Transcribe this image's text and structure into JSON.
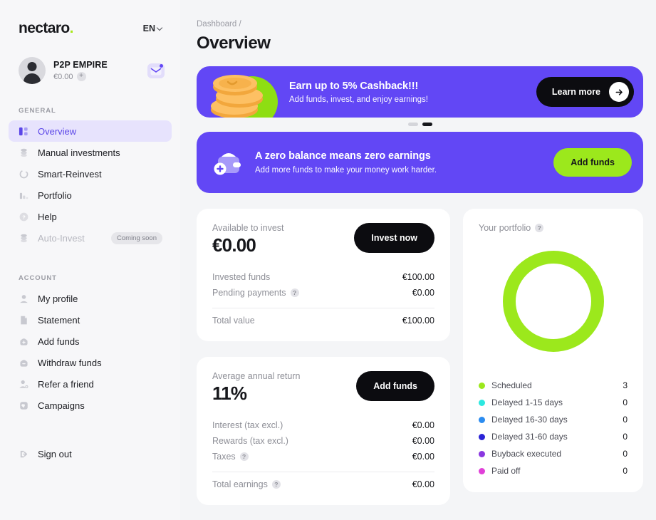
{
  "sidebar": {
    "logo": "nectaro",
    "logo_dot": ".",
    "language": "EN",
    "profile": {
      "name": "P2P EMPIRE",
      "balance": "€0.00",
      "add_symbol": "+",
      "mail_icon": "envelope-icon"
    },
    "group_general": "GENERAL",
    "group_account": "ACCOUNT",
    "general_items": [
      {
        "label": "Overview",
        "icon": "dashboard-icon",
        "active": true,
        "disabled": false
      },
      {
        "label": "Manual investments",
        "icon": "coins-stack-icon",
        "active": false,
        "disabled": false
      },
      {
        "label": "Smart-Reinvest",
        "icon": "refresh-icon",
        "active": false,
        "disabled": false
      },
      {
        "label": "Portfolio",
        "icon": "bar-chart-icon",
        "active": false,
        "disabled": false
      },
      {
        "label": "Help",
        "icon": "question-circle-icon",
        "active": false,
        "disabled": false
      },
      {
        "label": "Auto-Invest",
        "icon": "coins-stack-icon",
        "active": false,
        "disabled": true,
        "badge": "Coming soon"
      }
    ],
    "account_items": [
      {
        "label": "My profile",
        "icon": "user-icon"
      },
      {
        "label": "Statement",
        "icon": "document-icon"
      },
      {
        "label": "Add funds",
        "icon": "wallet-plus-icon"
      },
      {
        "label": "Withdraw funds",
        "icon": "wallet-minus-icon"
      },
      {
        "label": "Refer a friend",
        "icon": "user-gear-icon"
      },
      {
        "label": "Campaigns",
        "icon": "heart-badge-icon"
      }
    ],
    "sign_out": {
      "label": "Sign out",
      "icon": "sign-out-icon"
    }
  },
  "header": {
    "breadcrumb": "Dashboard /",
    "title": "Overview"
  },
  "promo": {
    "headline": "Earn up to 5% Cashback!!!",
    "subline": "Add funds, invest, and enjoy earnings!",
    "cta": "Learn more",
    "cta_icon": "arrow-right-icon",
    "art_icon": "gold-coins-icon",
    "accent": "#6247f5",
    "dots": [
      {
        "active": false
      },
      {
        "active": true
      }
    ]
  },
  "zero_banner": {
    "headline": "A zero balance means zero earnings",
    "subline": "Add more funds to make your money work harder.",
    "cta": "Add funds",
    "art_icon": "wallet-plus-icon",
    "accent": "#6247f5",
    "cta_color": "#9ce81c"
  },
  "available_card": {
    "label": "Available to invest",
    "value": "€0.00",
    "cta": "Invest now",
    "rows": [
      {
        "label": "Invested funds",
        "value": "€100.00",
        "info": false
      },
      {
        "label": "Pending payments",
        "value": "€0.00",
        "info": true
      }
    ],
    "total_label": "Total value",
    "total_value": "€100.00"
  },
  "return_card": {
    "label": "Average annual return",
    "value": "11%",
    "cta": "Add funds",
    "rows": [
      {
        "label": "Interest (tax excl.)",
        "value": "€0.00",
        "info": false
      },
      {
        "label": "Rewards (tax excl.)",
        "value": "€0.00",
        "info": false
      },
      {
        "label": "Taxes",
        "value": "€0.00",
        "info": true
      }
    ],
    "total_label": "Total earnings",
    "total_value": "€0.00",
    "total_info": true
  },
  "portfolio_card": {
    "title": "Your portfolio",
    "info_icon": "question-circle-icon"
  },
  "chart_data": {
    "type": "pie",
    "title": "Your portfolio",
    "categories": [
      "Scheduled",
      "Delayed 1-15 days",
      "Delayed 16-30 days",
      "Delayed 31-60 days",
      "Buyback executed",
      "Paid off"
    ],
    "values": [
      3,
      0,
      0,
      0,
      0,
      0
    ],
    "colors": [
      "#9ce81c",
      "#2ce8e0",
      "#2b8cf0",
      "#2a23d6",
      "#8a37e0",
      "#e040d8"
    ],
    "donut": true,
    "legend": "bottom",
    "total": 3
  }
}
